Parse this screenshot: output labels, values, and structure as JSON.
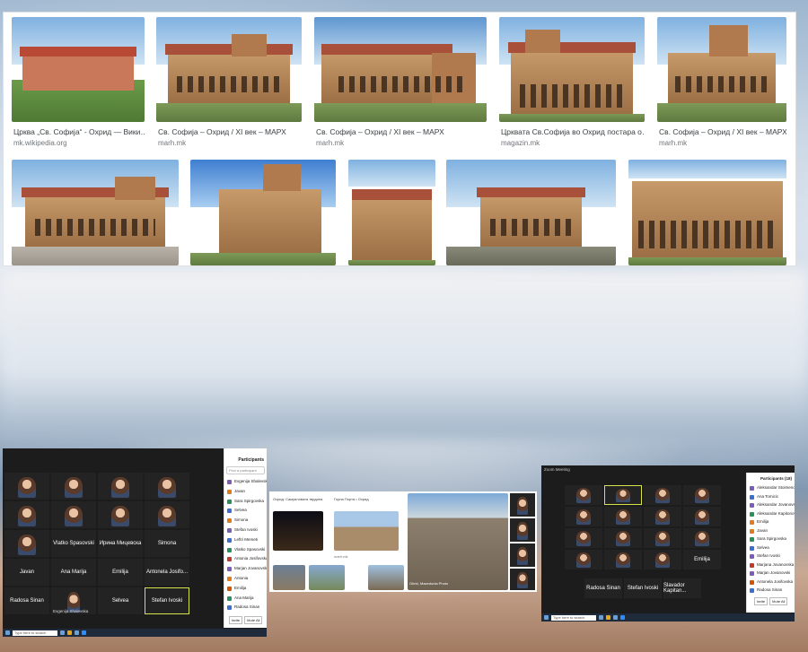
{
  "top_panel": {
    "row1": [
      {
        "caption": "Црква „Св. Софија“ - Охрид — Вики…",
        "source": "mk.wikipedia.org"
      },
      {
        "caption": "Св. Софија – Охрид / XI век – МАРХ",
        "source": "marh.mk"
      },
      {
        "caption": "Св. Софија – Охрид / XI век – МАРХ",
        "source": "marh.mk"
      },
      {
        "caption": "Црквата Св.Софија во Охрид постара о…",
        "source": "magazin.mk"
      },
      {
        "caption": "Св. Софија – Охрид / XI век – МАРХ",
        "source": "marh.mk"
      }
    ]
  },
  "zoom_left": {
    "panel_title": "Participants",
    "search_placeholder": "Find a participant",
    "participants": [
      "Evgenija Shalevska",
      "Javan",
      "Sara Spirgovska",
      "Selvea",
      "Simona",
      "Stefan Ivoski",
      "Leftri Memeti",
      "Vlatko Spasovski",
      "Antonia Josifovska",
      "Marjan Jovanovski",
      "Antonia",
      "Emilija",
      "Ana Marija",
      "Radosa Sinan"
    ],
    "tiles": [
      {
        "name": "Vlatko Spasovski"
      },
      {
        "name": "Ирина Мицевска"
      },
      {
        "name": "Simona"
      },
      {
        "name": "Javan"
      },
      {
        "name": "Ana Marija"
      },
      {
        "name": "Emilija"
      },
      {
        "name": "Antonela Josifo..."
      },
      {
        "name": "Radosa Sinan"
      },
      {
        "name": "Evgenija Shalevska"
      },
      {
        "name": "Selvea"
      },
      {
        "name": "Stefan Ivoski"
      }
    ],
    "taskbar_search": "Type here to search",
    "buttons": {
      "invite": "Invite",
      "mute": "Mute All",
      "ask": "Ask to Unmute"
    }
  },
  "zoom_right": {
    "window_title": "Zoom Meeting",
    "panel_title": "Participants (18)",
    "participants": [
      "Aleksandar Stoimenovski",
      "Ana Tomicic",
      "Aleksandar Jovanovski",
      "Aleksandar Kapitonov",
      "Emilija",
      "Javan",
      "Sara Spirgovska",
      "Selvea",
      "Stefan Ivoski",
      "Marjana Jovanovska",
      "Marjan Jovanovski",
      "Antonela Josifovska",
      "Radosa Sinan"
    ],
    "tiles": [
      {
        "name": "Emilija"
      },
      {
        "name": "Radosa Sinan"
      },
      {
        "name": "Stefan Ivoski"
      },
      {
        "name": "Slavador Kapitan..."
      }
    ],
    "taskbar_search": "Type here to search",
    "buttons": {
      "invite": "Invite",
      "mute": "Mute All"
    }
  },
  "center_shot": {
    "items": [
      {
        "caption": "Охрид: Самуиловата тврдина",
        "source": "wikipedia.org"
      },
      {
        "caption": "Горна Порта • Охрид",
        "source": "marh.mk"
      },
      {
        "caption": "Ohrid, Macedonia Photo",
        "source": "alamy.com"
      }
    ]
  },
  "colors": {
    "panel_bg": "#ffffff",
    "zoom_bg": "#1c1c1c",
    "taskbar": "#1f2a3a",
    "highlight": "#d8e24a"
  }
}
